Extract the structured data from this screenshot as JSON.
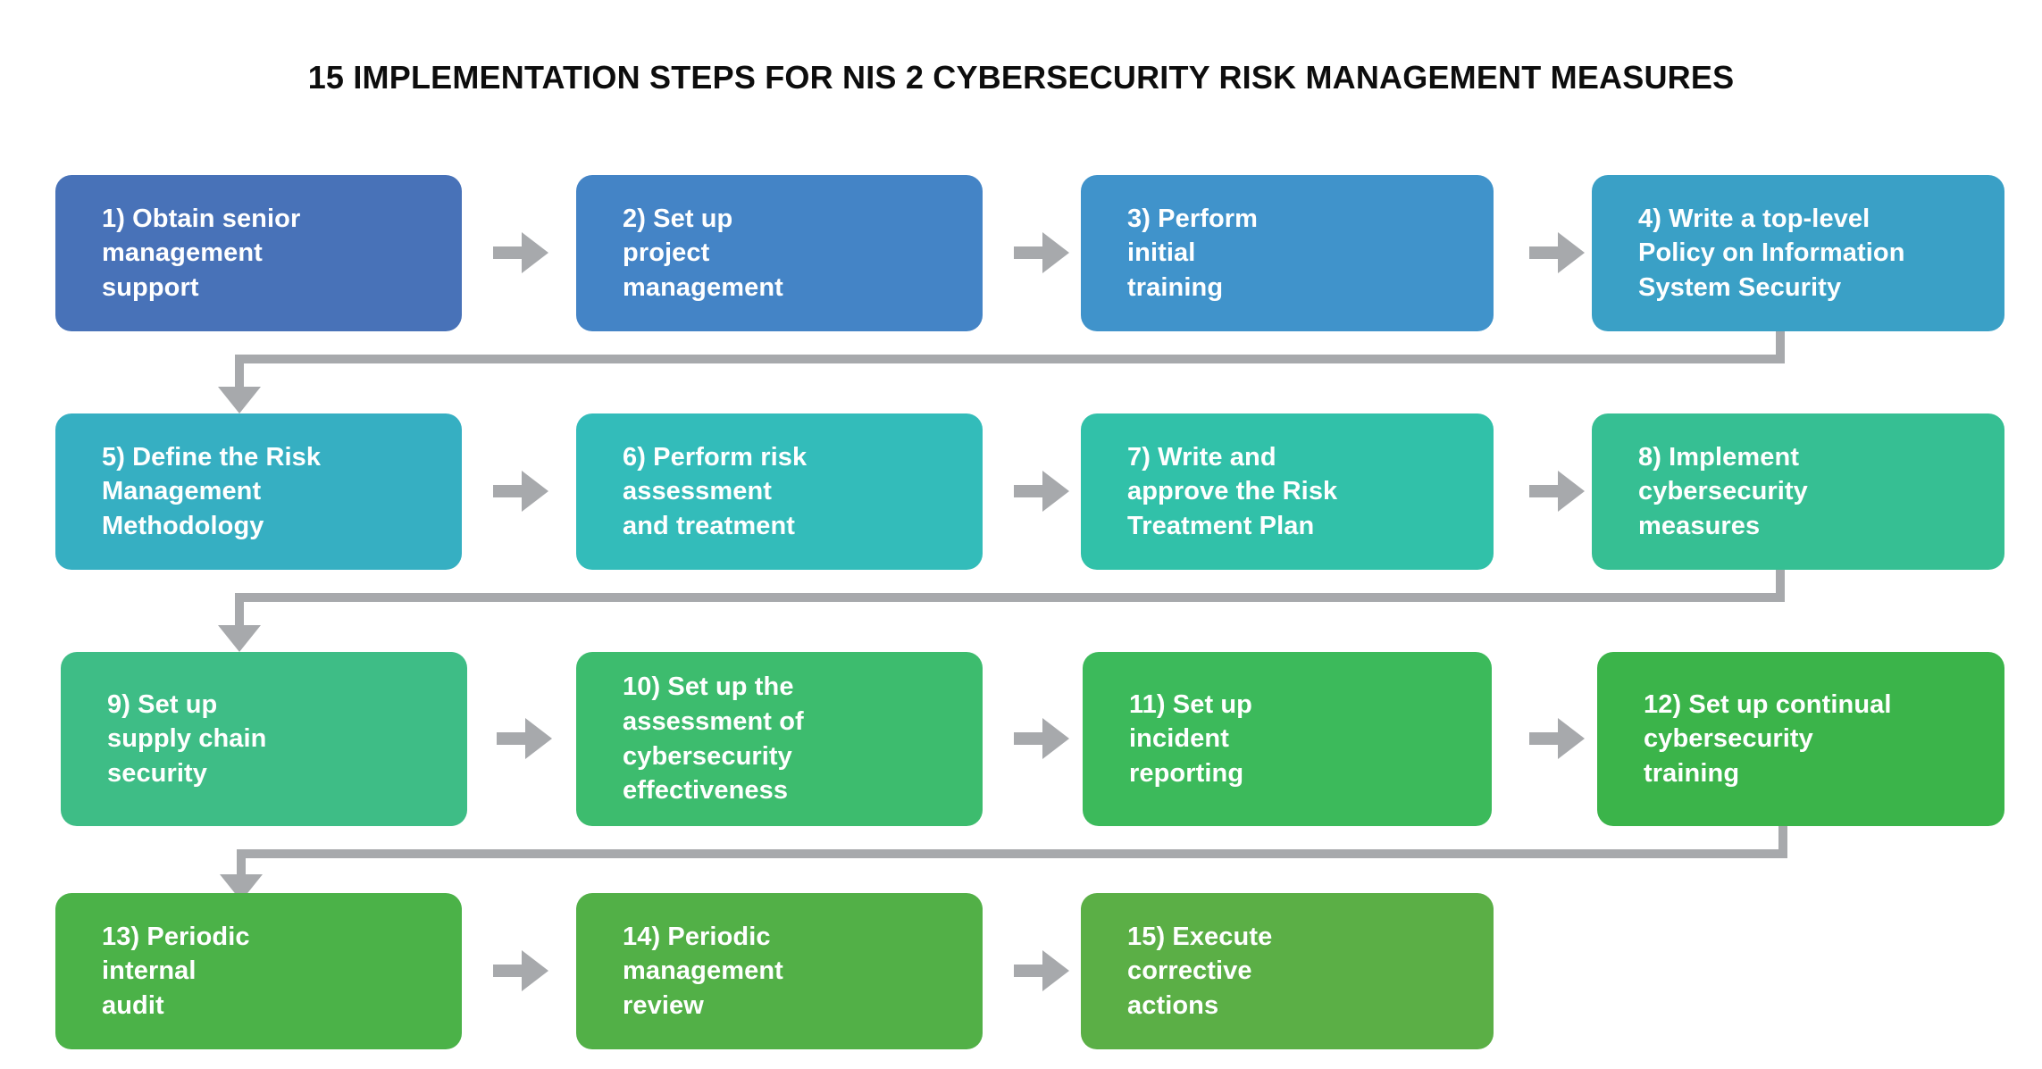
{
  "title": "15 IMPLEMENTATION STEPS FOR NIS 2 CYBERSECURITY RISK MANAGEMENT MEASURES",
  "colors": {
    "background": "#FFFFFF",
    "title_text": "#0D0D0D",
    "box_text": "#FFFFFF",
    "arrow": "#A7A9AC"
  },
  "steps": [
    {
      "number": "1)",
      "label": "1) Obtain senior\nmanagement\nsupport",
      "color": "#4872B8"
    },
    {
      "number": "2)",
      "label": "2) Set up\nproject\nmanagement",
      "color": "#4484C6"
    },
    {
      "number": "3)",
      "label": "3) Perform\ninitial\ntraining",
      "color": "#4093CB"
    },
    {
      "number": "4)",
      "label": "4) Write a top-level\nPolicy on Information\nSystem Security",
      "color": "#3AA0C6"
    },
    {
      "number": "5)",
      "label": "5) Define the Risk\nManagement\nMethodology",
      "color": "#36AFC2"
    },
    {
      "number": "6)",
      "label": "6) Perform risk\nassessment\nand treatment",
      "color": "#33BCBA"
    },
    {
      "number": "7)",
      "label": "7) Write and\napprove the Risk\nTreatment Plan",
      "color": "#31C1A9"
    },
    {
      "number": "8)",
      "label": "8) Implement\ncybersecurity\nmeasures",
      "color": "#36BF93"
    },
    {
      "number": "9)",
      "label": "9) Set up\nsupply chain\nsecurity",
      "color": "#3EBD86"
    },
    {
      "number": "10)",
      "label": "10) Set up the\nassessment of\ncybersecurity\neffectiveness",
      "color": "#3DBC6E"
    },
    {
      "number": "11)",
      "label": "11) Set up\nincident\nreporting",
      "color": "#3CBA5B"
    },
    {
      "number": "12)",
      "label": "12) Set up continual\ncybersecurity\ntraining",
      "color": "#3BB44A"
    },
    {
      "number": "13)",
      "label": "13) Periodic\ninternal\naudit",
      "color": "#4BB248"
    },
    {
      "number": "14)",
      "label": "14) Periodic\nmanagement\nreview",
      "color": "#52B047"
    },
    {
      "number": "15)",
      "label": "15) Execute\ncorrective\nactions",
      "color": "#5BAF46"
    }
  ]
}
